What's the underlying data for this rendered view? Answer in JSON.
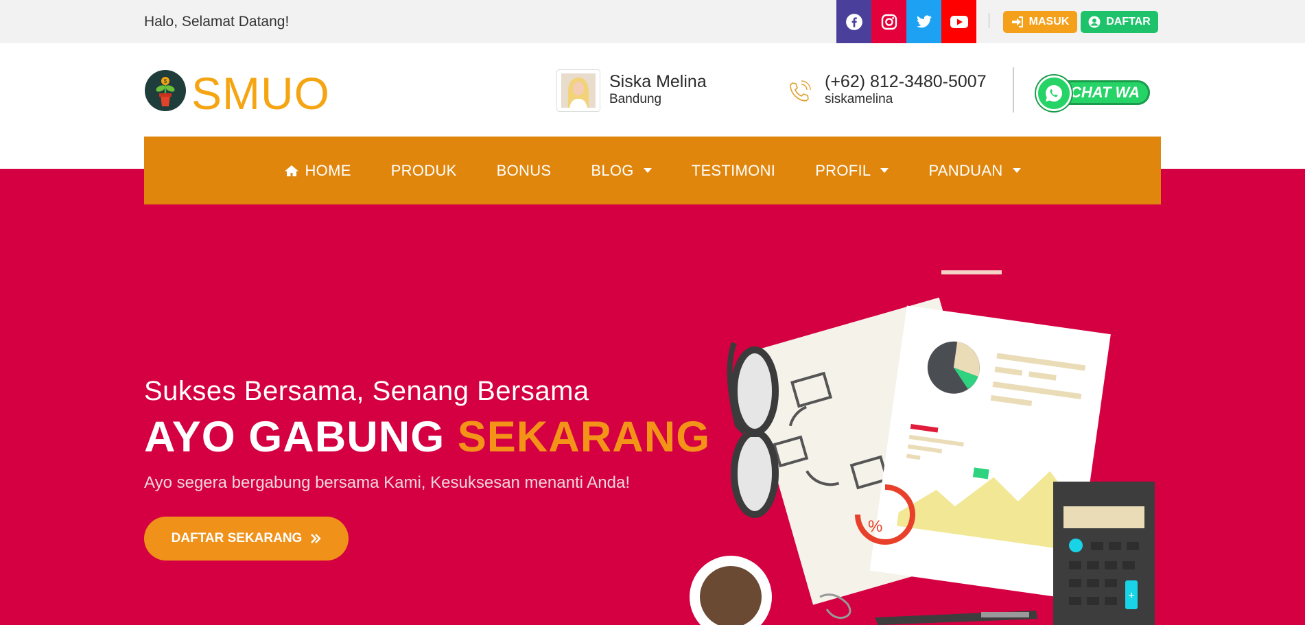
{
  "topbar": {
    "greeting": "Halo, Selamat Datang!",
    "social": [
      {
        "icon": "facebook-icon",
        "color": "#4a3f9b"
      },
      {
        "icon": "instagram-icon",
        "color": "#e4003a"
      },
      {
        "icon": "twitter-icon",
        "color": "#1da1f2"
      },
      {
        "icon": "youtube-icon",
        "color": "#ff0000"
      }
    ],
    "login_label": "MASUK",
    "register_label": "DAFTAR",
    "login_color": "#f5a01a",
    "register_color": "#1ec26b"
  },
  "header": {
    "logo_text": "SMUO",
    "contact_name": "Siska Melina",
    "contact_city": "Bandung",
    "phone": "(+62) 812-3480-5007",
    "username": "siskamelina",
    "chat_label": "CHAT WA"
  },
  "nav": {
    "items": [
      {
        "label": "HOME",
        "icon": "home-icon"
      },
      {
        "label": "PRODUK"
      },
      {
        "label": "BONUS"
      },
      {
        "label": "BLOG",
        "dropdown": true
      },
      {
        "label": "TESTIMONI"
      },
      {
        "label": "PROFIL",
        "dropdown": true
      },
      {
        "label": "PANDUAN",
        "dropdown": true
      }
    ],
    "bg_color": "#e0860d"
  },
  "hero": {
    "subtitle": "Sukses Bersama, Senang Bersama",
    "title_main": "AYO GABUNG ",
    "title_highlight": "SEKARANG",
    "description": "Ayo segera bergabung bersama Kami, Kesuksesan menanti Anda!",
    "cta_label": "DAFTAR SEKARANG",
    "bg_color": "#d40042",
    "accent_color": "#f39419"
  }
}
